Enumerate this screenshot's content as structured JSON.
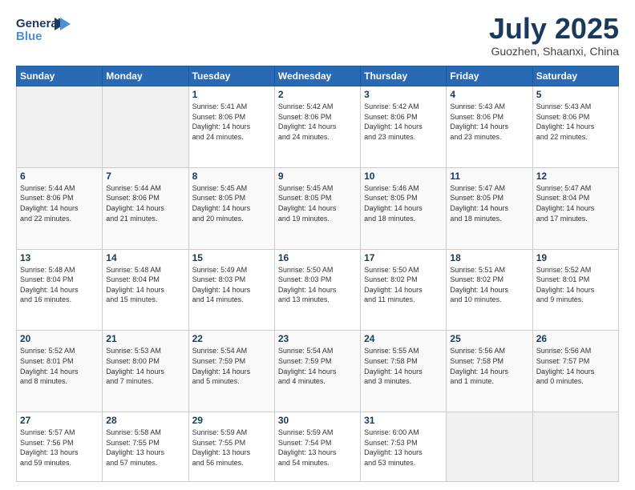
{
  "header": {
    "logo_line1": "General",
    "logo_line2": "Blue",
    "month": "July 2025",
    "location": "Guozhen, Shaanxi, China"
  },
  "weekdays": [
    "Sunday",
    "Monday",
    "Tuesday",
    "Wednesday",
    "Thursday",
    "Friday",
    "Saturday"
  ],
  "weeks": [
    [
      {
        "day": "",
        "info": ""
      },
      {
        "day": "",
        "info": ""
      },
      {
        "day": "1",
        "info": "Sunrise: 5:41 AM\nSunset: 8:06 PM\nDaylight: 14 hours\nand 24 minutes."
      },
      {
        "day": "2",
        "info": "Sunrise: 5:42 AM\nSunset: 8:06 PM\nDaylight: 14 hours\nand 24 minutes."
      },
      {
        "day": "3",
        "info": "Sunrise: 5:42 AM\nSunset: 8:06 PM\nDaylight: 14 hours\nand 23 minutes."
      },
      {
        "day": "4",
        "info": "Sunrise: 5:43 AM\nSunset: 8:06 PM\nDaylight: 14 hours\nand 23 minutes."
      },
      {
        "day": "5",
        "info": "Sunrise: 5:43 AM\nSunset: 8:06 PM\nDaylight: 14 hours\nand 22 minutes."
      }
    ],
    [
      {
        "day": "6",
        "info": "Sunrise: 5:44 AM\nSunset: 8:06 PM\nDaylight: 14 hours\nand 22 minutes."
      },
      {
        "day": "7",
        "info": "Sunrise: 5:44 AM\nSunset: 8:06 PM\nDaylight: 14 hours\nand 21 minutes."
      },
      {
        "day": "8",
        "info": "Sunrise: 5:45 AM\nSunset: 8:05 PM\nDaylight: 14 hours\nand 20 minutes."
      },
      {
        "day": "9",
        "info": "Sunrise: 5:45 AM\nSunset: 8:05 PM\nDaylight: 14 hours\nand 19 minutes."
      },
      {
        "day": "10",
        "info": "Sunrise: 5:46 AM\nSunset: 8:05 PM\nDaylight: 14 hours\nand 18 minutes."
      },
      {
        "day": "11",
        "info": "Sunrise: 5:47 AM\nSunset: 8:05 PM\nDaylight: 14 hours\nand 18 minutes."
      },
      {
        "day": "12",
        "info": "Sunrise: 5:47 AM\nSunset: 8:04 PM\nDaylight: 14 hours\nand 17 minutes."
      }
    ],
    [
      {
        "day": "13",
        "info": "Sunrise: 5:48 AM\nSunset: 8:04 PM\nDaylight: 14 hours\nand 16 minutes."
      },
      {
        "day": "14",
        "info": "Sunrise: 5:48 AM\nSunset: 8:04 PM\nDaylight: 14 hours\nand 15 minutes."
      },
      {
        "day": "15",
        "info": "Sunrise: 5:49 AM\nSunset: 8:03 PM\nDaylight: 14 hours\nand 14 minutes."
      },
      {
        "day": "16",
        "info": "Sunrise: 5:50 AM\nSunset: 8:03 PM\nDaylight: 14 hours\nand 13 minutes."
      },
      {
        "day": "17",
        "info": "Sunrise: 5:50 AM\nSunset: 8:02 PM\nDaylight: 14 hours\nand 11 minutes."
      },
      {
        "day": "18",
        "info": "Sunrise: 5:51 AM\nSunset: 8:02 PM\nDaylight: 14 hours\nand 10 minutes."
      },
      {
        "day": "19",
        "info": "Sunrise: 5:52 AM\nSunset: 8:01 PM\nDaylight: 14 hours\nand 9 minutes."
      }
    ],
    [
      {
        "day": "20",
        "info": "Sunrise: 5:52 AM\nSunset: 8:01 PM\nDaylight: 14 hours\nand 8 minutes."
      },
      {
        "day": "21",
        "info": "Sunrise: 5:53 AM\nSunset: 8:00 PM\nDaylight: 14 hours\nand 7 minutes."
      },
      {
        "day": "22",
        "info": "Sunrise: 5:54 AM\nSunset: 7:59 PM\nDaylight: 14 hours\nand 5 minutes."
      },
      {
        "day": "23",
        "info": "Sunrise: 5:54 AM\nSunset: 7:59 PM\nDaylight: 14 hours\nand 4 minutes."
      },
      {
        "day": "24",
        "info": "Sunrise: 5:55 AM\nSunset: 7:58 PM\nDaylight: 14 hours\nand 3 minutes."
      },
      {
        "day": "25",
        "info": "Sunrise: 5:56 AM\nSunset: 7:58 PM\nDaylight: 14 hours\nand 1 minute."
      },
      {
        "day": "26",
        "info": "Sunrise: 5:56 AM\nSunset: 7:57 PM\nDaylight: 14 hours\nand 0 minutes."
      }
    ],
    [
      {
        "day": "27",
        "info": "Sunrise: 5:57 AM\nSunset: 7:56 PM\nDaylight: 13 hours\nand 59 minutes."
      },
      {
        "day": "28",
        "info": "Sunrise: 5:58 AM\nSunset: 7:55 PM\nDaylight: 13 hours\nand 57 minutes."
      },
      {
        "day": "29",
        "info": "Sunrise: 5:59 AM\nSunset: 7:55 PM\nDaylight: 13 hours\nand 56 minutes."
      },
      {
        "day": "30",
        "info": "Sunrise: 5:59 AM\nSunset: 7:54 PM\nDaylight: 13 hours\nand 54 minutes."
      },
      {
        "day": "31",
        "info": "Sunrise: 6:00 AM\nSunset: 7:53 PM\nDaylight: 13 hours\nand 53 minutes."
      },
      {
        "day": "",
        "info": ""
      },
      {
        "day": "",
        "info": ""
      }
    ]
  ]
}
